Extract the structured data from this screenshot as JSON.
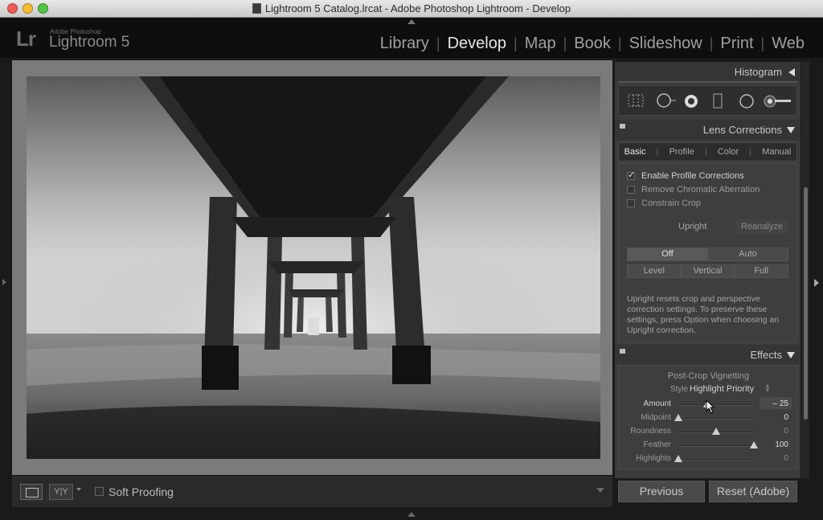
{
  "window": {
    "title": "Lightroom 5 Catalog.lrcat - Adobe Photoshop Lightroom - Develop"
  },
  "header": {
    "logo_mark": "Lr",
    "logo_small": "Adobe Photoshop",
    "product": "Lightroom 5",
    "modules": [
      "Library",
      "Develop",
      "Map",
      "Book",
      "Slideshow",
      "Print",
      "Web"
    ],
    "active_module": "Develop"
  },
  "toolbar": {
    "yy_label": "Y|Y",
    "soft_proofing_label": "Soft Proofing",
    "soft_proofing_checked": false
  },
  "panels": {
    "histogram": {
      "title": "Histogram"
    },
    "tools": [
      "grid-overlay-icon",
      "crop-overlay-icon",
      "spot-removal-icon",
      "red-eye-icon",
      "graduated-filter-icon",
      "radial-filter-icon",
      "adjustment-brush-icon"
    ],
    "lens_corrections": {
      "title": "Lens Corrections",
      "tabs": [
        "Basic",
        "Profile",
        "Color",
        "Manual"
      ],
      "active_tab": "Basic",
      "checks": [
        {
          "label": "Enable Profile Corrections",
          "checked": true
        },
        {
          "label": "Remove Chromatic Aberration",
          "checked": false
        },
        {
          "label": "Constrain Crop",
          "checked": false
        }
      ],
      "upright_label": "Upright",
      "reanalyze_label": "Reanalyze",
      "upright_row1": [
        "Off",
        "Auto"
      ],
      "upright_row2": [
        "Level",
        "Vertical",
        "Full"
      ],
      "upright_active": "Off",
      "note": "Upright resets crop and perspective correction settings. To preserve these settings, press Option when choosing an Upright correction."
    },
    "effects": {
      "title": "Effects",
      "subtitle": "Post-Crop Vignetting",
      "style_label": "Style",
      "style_value": "Highlight Priority",
      "sliders": [
        {
          "label": "Amount",
          "value": "– 25",
          "position": 0.38
        },
        {
          "label": "Midpoint",
          "value": "0",
          "position": 0.0
        },
        {
          "label": "Roundness",
          "value": "0",
          "position": 0.5
        },
        {
          "label": "Feather",
          "value": "100",
          "position": 1.0
        },
        {
          "label": "Highlights",
          "value": "0",
          "position": 0.0
        }
      ]
    }
  },
  "buttons": {
    "previous": "Previous",
    "reset": "Reset (Adobe)"
  }
}
